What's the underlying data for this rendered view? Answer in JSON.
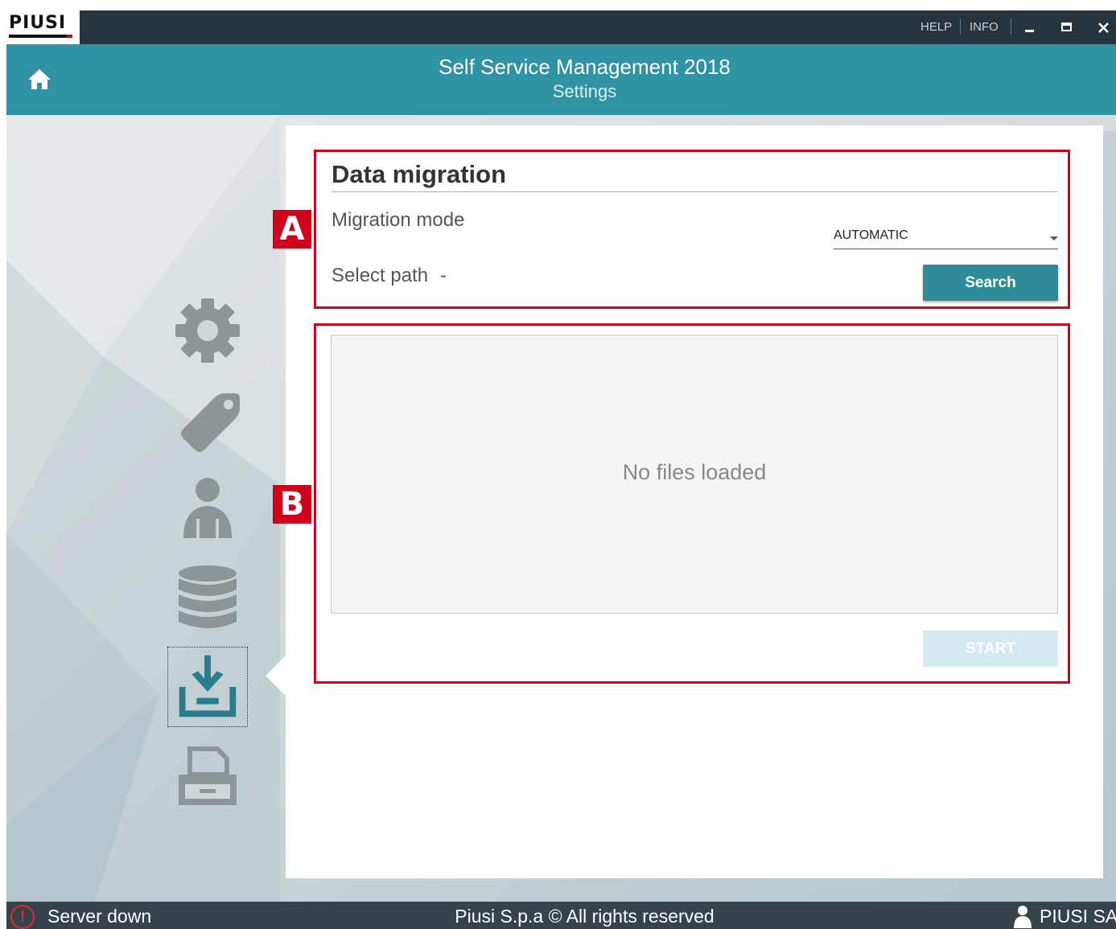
{
  "window": {
    "logo": "PIUSI",
    "help_label": "HELP",
    "info_label": "INFO",
    "minimize_icon": "minimize-icon",
    "maximize_icon": "maximize-icon",
    "close_icon": "close-icon"
  },
  "header": {
    "title": "Self Service Management 2018",
    "subtitle": "Settings",
    "home_icon": "home-icon"
  },
  "sidebar": {
    "items": [
      {
        "name": "settings",
        "icon": "gear-icon"
      },
      {
        "name": "tags",
        "icon": "tag-icon"
      },
      {
        "name": "users",
        "icon": "user-icon"
      },
      {
        "name": "database",
        "icon": "database-icon"
      },
      {
        "name": "data-migration",
        "icon": "download-tray-icon",
        "active": true
      },
      {
        "name": "printer",
        "icon": "printer-icon"
      }
    ]
  },
  "data_migration": {
    "title": "Data migration",
    "mode_label": "Migration mode",
    "mode_value": "AUTOMATIC",
    "path_label": "Select path",
    "path_value": "-",
    "search_button": "Search",
    "files_empty_text": "No files loaded",
    "start_button": "START"
  },
  "annotations": {
    "a_label": "A",
    "b_label": "B",
    "color": "#d0021b"
  },
  "footer": {
    "status_icon": "!",
    "status_text": "Server down",
    "copyright": "Piusi S.p.a © All rights reserved",
    "user_name": "PIUSI SAT"
  },
  "colors": {
    "titlebar": "#26343f",
    "header": "#2f93a4",
    "accent": "#2f8c99",
    "footer": "#37434b"
  }
}
